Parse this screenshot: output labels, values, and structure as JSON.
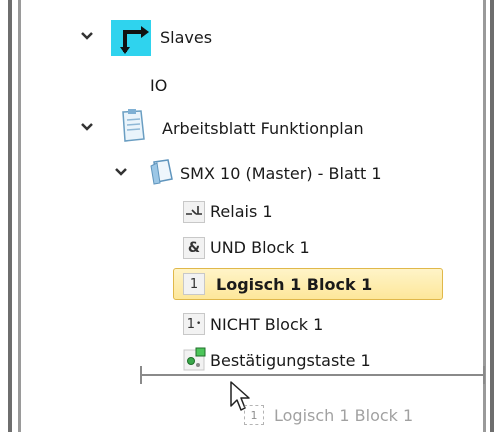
{
  "tree": {
    "slaves": {
      "label": "Slaves",
      "icon": "slaves-icon"
    },
    "io": {
      "label": "IO"
    },
    "worksheet": {
      "label": "Arbeitsblatt Funktionplan",
      "icon": "worksheet-icon"
    },
    "master": {
      "label": "SMX 10 (Master) - Blatt 1",
      "icon": "sheet-icon"
    },
    "items": [
      {
        "label": "Relais 1",
        "icon": "relay-icon",
        "glyph": ""
      },
      {
        "label": "UND Block 1",
        "icon": "and-block-icon",
        "glyph": "&"
      },
      {
        "label": "Logisch 1 Block 1",
        "icon": "logic-1-block-icon",
        "glyph": "1",
        "selected": true
      },
      {
        "label": "NICHT Block 1",
        "icon": "not-block-icon",
        "glyph": "1"
      },
      {
        "label": "Bestätigungstaste 1",
        "icon": "confirm-button-icon",
        "glyph": ""
      }
    ]
  },
  "drag": {
    "label": "Logisch 1 Block 1"
  },
  "colors": {
    "selection": "#fde79a",
    "slaves_icon_bg": "#2fd3ee"
  }
}
